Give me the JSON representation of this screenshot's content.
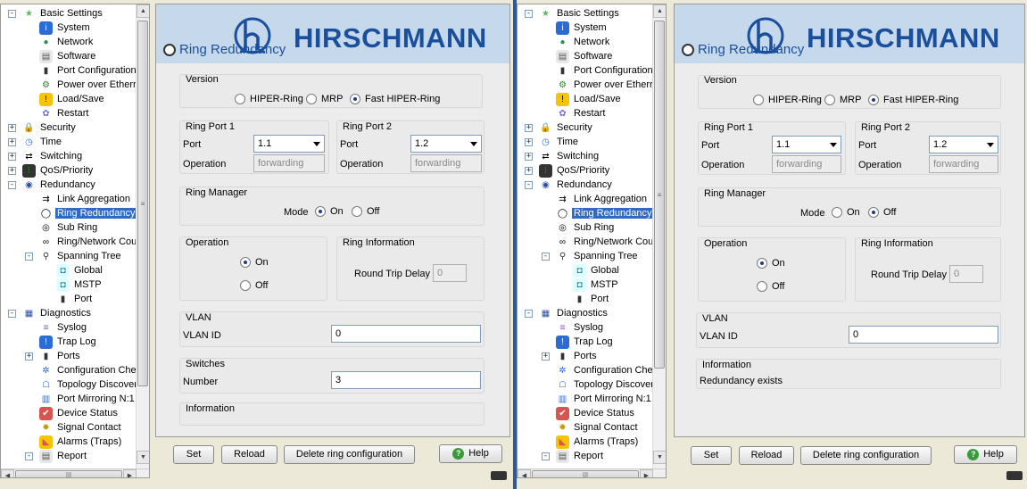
{
  "brand": {
    "name": "HIRSCHMANN",
    "logo_letter": "h"
  },
  "page": {
    "title": "Ring Redundancy"
  },
  "tree": {
    "items": [
      {
        "label": "Basic Settings",
        "icon": "star-icon"
      },
      {
        "label": "System",
        "icon": "info-icon"
      },
      {
        "label": "Network",
        "icon": "network-icon"
      },
      {
        "label": "Software",
        "icon": "software-icon"
      },
      {
        "label": "Port Configuration",
        "icon": "port-icon"
      },
      {
        "label": "Power over Etherr",
        "icon": "power-icon"
      },
      {
        "label": "Load/Save",
        "icon": "warning-icon"
      },
      {
        "label": "Restart",
        "icon": "gear-icon"
      },
      {
        "label": "Security",
        "icon": "lock-icon"
      },
      {
        "label": "Time",
        "icon": "clock-icon"
      },
      {
        "label": "Switching",
        "icon": "switch-icon"
      },
      {
        "label": "QoS/Priority",
        "icon": "traffic-light-icon"
      },
      {
        "label": "Redundancy",
        "icon": "redundancy-icon"
      },
      {
        "label": "Link Aggregation",
        "icon": "link-icon"
      },
      {
        "label": "Ring Redundancy",
        "icon": "ring-icon"
      },
      {
        "label": "Sub Ring",
        "icon": "subring-icon"
      },
      {
        "label": "Ring/Network Cou",
        "icon": "coupling-icon"
      },
      {
        "label": "Spanning Tree",
        "icon": "tree-icon"
      },
      {
        "label": "Global",
        "icon": "global-icon"
      },
      {
        "label": "MSTP",
        "icon": "mstp-icon"
      },
      {
        "label": "Port",
        "icon": "port-icon"
      },
      {
        "label": "Diagnostics",
        "icon": "diagnostics-icon"
      },
      {
        "label": "Syslog",
        "icon": "syslog-icon"
      },
      {
        "label": "Trap Log",
        "icon": "alert-icon"
      },
      {
        "label": "Ports",
        "icon": "port-icon"
      },
      {
        "label": "Configuration Chec",
        "icon": "config-check-icon"
      },
      {
        "label": "Topology Discover",
        "icon": "topology-icon"
      },
      {
        "label": "Port Mirroring N:1",
        "icon": "mirror-icon"
      },
      {
        "label": "Device Status",
        "icon": "check-icon"
      },
      {
        "label": "Signal Contact",
        "icon": "signal-icon"
      },
      {
        "label": "Alarms (Traps)",
        "icon": "alarm-icon"
      },
      {
        "label": "Report",
        "icon": "report-icon"
      }
    ]
  },
  "version": {
    "title": "Version",
    "options": [
      "HIPER-Ring",
      "MRP",
      "Fast HIPER-Ring"
    ],
    "selected": "Fast HIPER-Ring"
  },
  "ring_port_1": {
    "title": "Ring Port 1",
    "port_label": "Port",
    "port": "1.1",
    "op_label": "Operation",
    "operation": "forwarding"
  },
  "ring_port_2": {
    "title": "Ring Port 2",
    "port_label": "Port",
    "port": "1.2",
    "op_label": "Operation",
    "operation": "forwarding"
  },
  "ring_manager": {
    "title": "Ring Manager",
    "mode_label": "Mode",
    "on": "On",
    "off": "Off"
  },
  "operation": {
    "title": "Operation",
    "on": "On",
    "off": "Off"
  },
  "ring_info": {
    "title": "Ring Information",
    "rtd_label": "Round Trip Delay",
    "rtd": "0"
  },
  "vlan": {
    "title": "VLAN",
    "id_label": "VLAN ID",
    "id": "0"
  },
  "switches": {
    "title": "Switches",
    "number_label": "Number",
    "number": "3"
  },
  "information": {
    "title": "Information",
    "text": "Redundancy exists"
  },
  "buttons": {
    "set": "Set",
    "reload": "Reload",
    "delete": "Delete ring configuration",
    "help": "Help"
  },
  "left": {
    "ring_manager_mode": "On",
    "operation": "On"
  },
  "right": {
    "ring_manager_mode": "Off",
    "operation": "On"
  },
  "colors": {
    "banner": "#c6d9ec",
    "brand": "#1a4f9c",
    "selection": "#3069c6"
  }
}
